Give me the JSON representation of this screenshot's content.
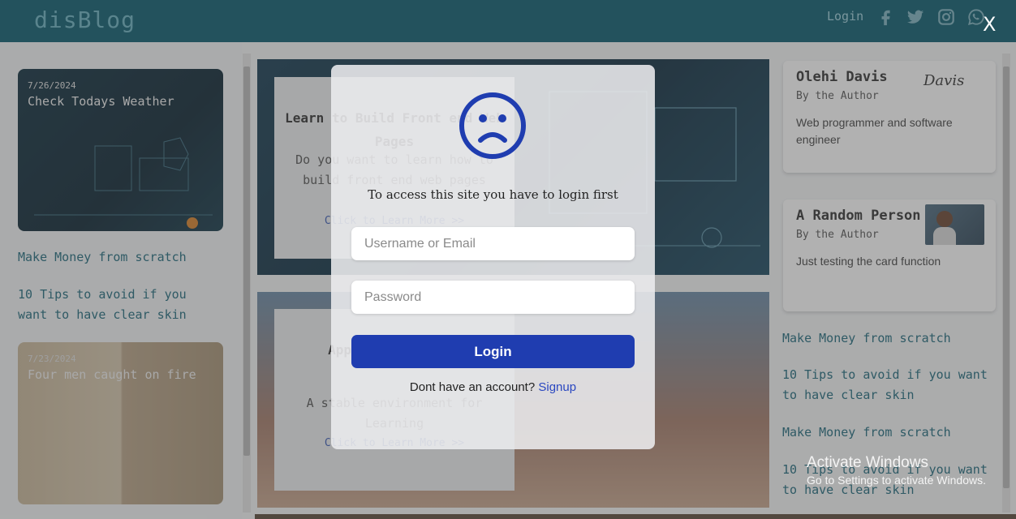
{
  "header": {
    "logo": "disBlog",
    "login_label": "Login",
    "social_icons": [
      "facebook-icon",
      "twitter-icon",
      "instagram-icon",
      "whatsapp-icon"
    ]
  },
  "left_column": {
    "cards": [
      {
        "date": "7/26/2024",
        "title": "Check Todays Weather"
      },
      {
        "date": "7/23/2024",
        "title": "Four men caught on fire"
      }
    ],
    "links": [
      "Make Money from scratch",
      "10 Tips to avoid if you want to have clear skin"
    ]
  },
  "center": {
    "features": [
      {
        "title": "Learn to Build Front end Web Pages",
        "desc": "Do you want to learn how to build front end web pages",
        "link": "Click to Learn More >>"
      },
      {
        "title": "Apply to a School",
        "desc": "A stable environment for Learning",
        "link": "Click to Learn More >>"
      }
    ]
  },
  "right_column": {
    "authors": [
      {
        "name": "Olehi Davis",
        "by": "By the Author",
        "desc": "Web programmer and software engineer",
        "signature": "Davis"
      },
      {
        "name": "A Random Person",
        "by": "By the Author",
        "desc": "Just testing the card function"
      }
    ],
    "links": [
      "Make Money from scratch",
      "10 Tips to avoid if you want to have clear skin",
      "Make Money from scratch",
      "10 Tips to avoid if you want to have clear skin"
    ]
  },
  "modal": {
    "close_label": "X",
    "icon": "sad-face-icon",
    "message": "To access this site you have to login first",
    "username_placeholder": "Username or Email",
    "password_placeholder": "Password",
    "login_button": "Login",
    "signup_prompt": "Dont have an account?",
    "signup_link": "Signup",
    "accent_color": "#1f3db0"
  },
  "watermark": {
    "title": "Activate Windows",
    "subtitle": "Go to Settings to activate Windows."
  }
}
